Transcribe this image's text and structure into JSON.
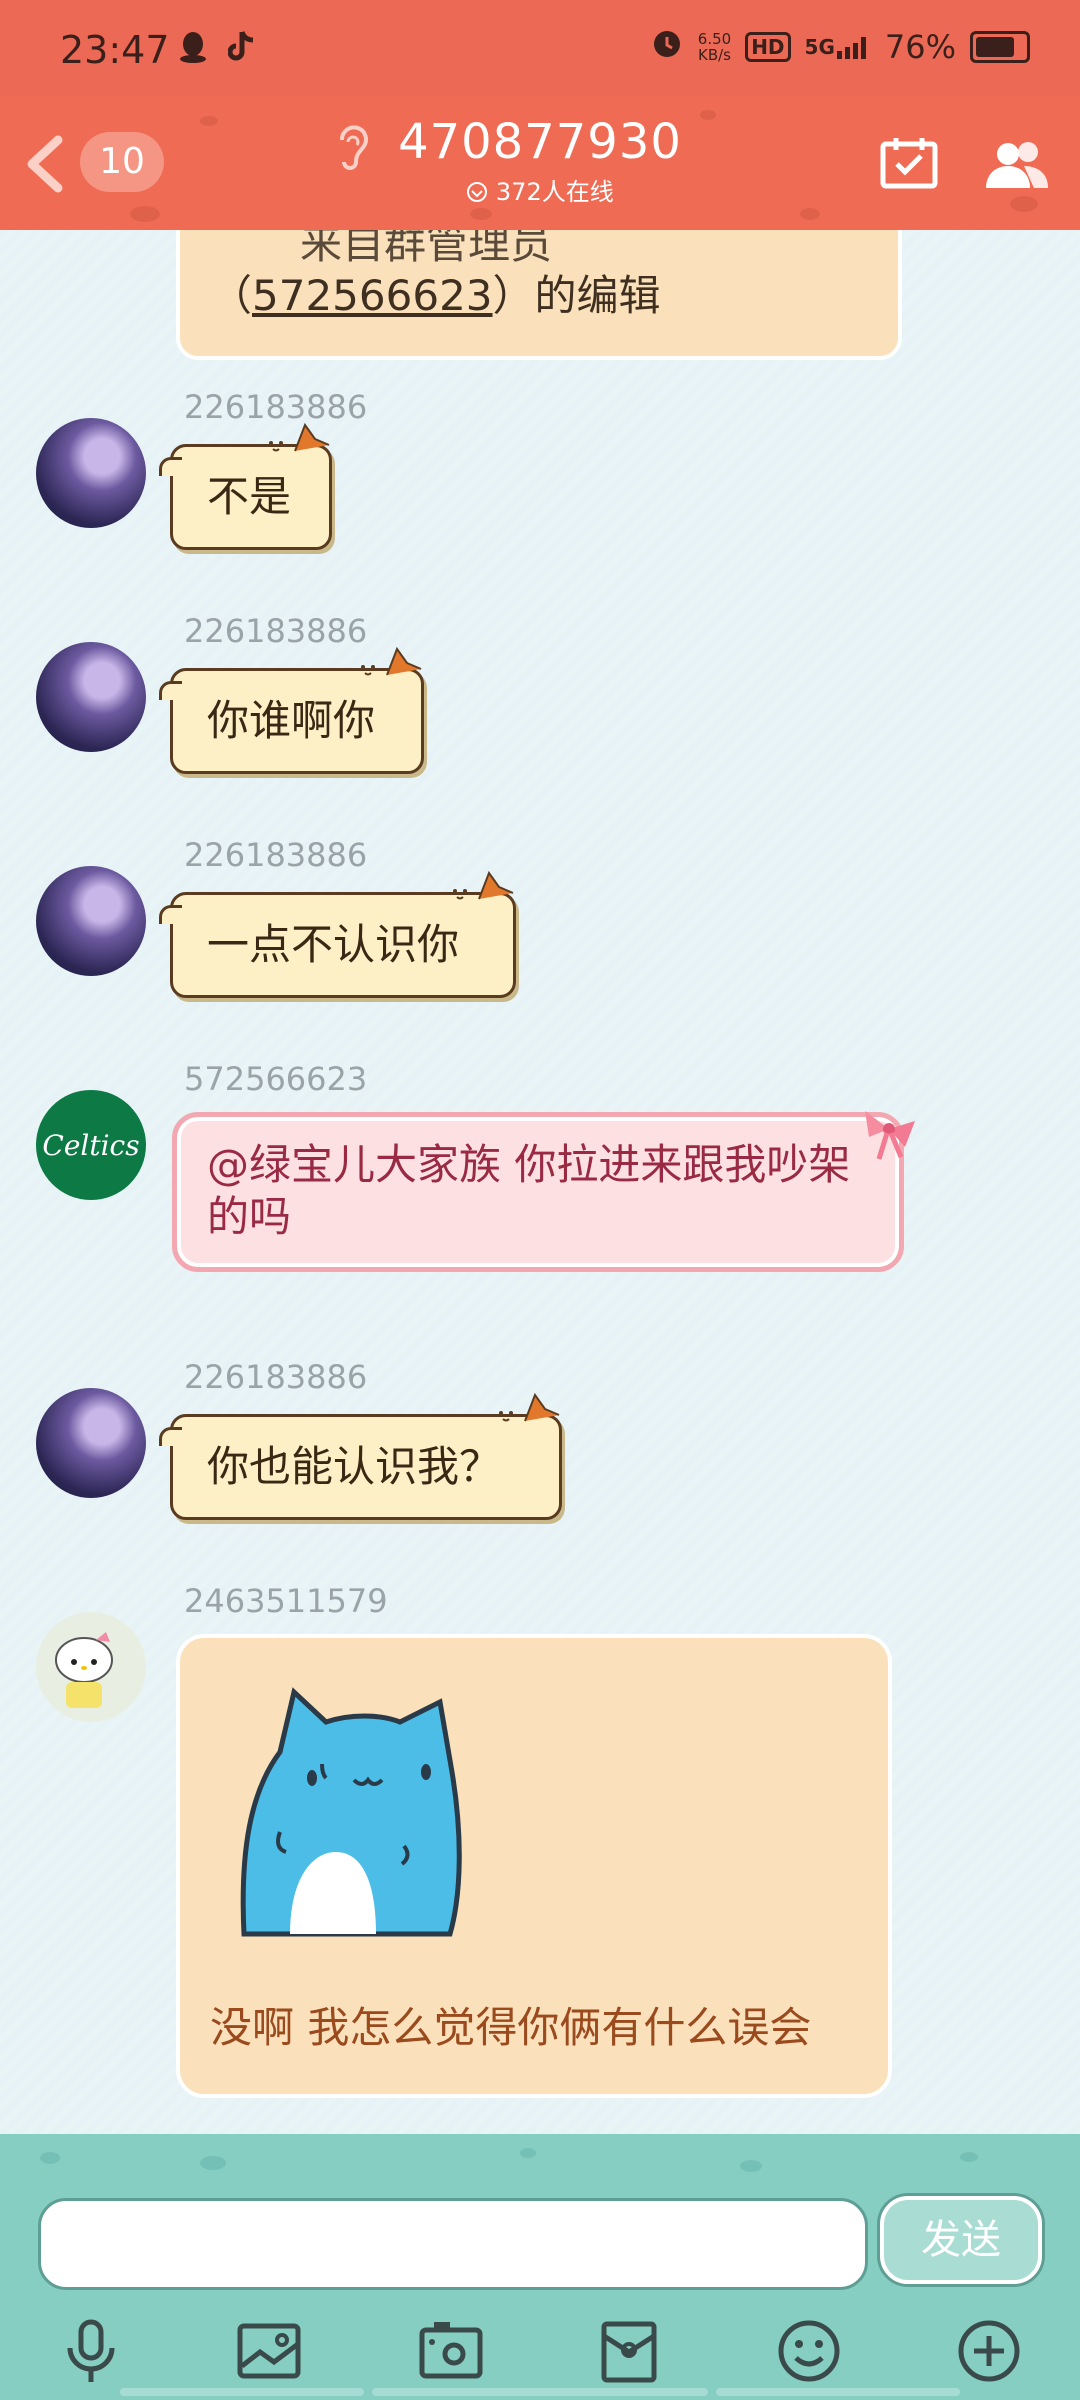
{
  "status_bar": {
    "time": "23:47",
    "left_icons": [
      "qq-icon",
      "tiktok-icon"
    ],
    "alarm_icon": "alarm-icon",
    "net_speed_value": "6.50",
    "net_speed_unit": "KB/s",
    "hd_label": "HD",
    "network_label": "5G",
    "battery_percent": "76%"
  },
  "header": {
    "unread_count": "10",
    "group_number": "470877930",
    "online_text": "372人在线"
  },
  "notice": {
    "line1": "来自群管理员",
    "line2_open": "（",
    "line2_id": "572566623",
    "line2_close": "）的编辑"
  },
  "messages": [
    {
      "sender": "226183886",
      "text": "不是"
    },
    {
      "sender": "226183886",
      "text": "你谁啊你"
    },
    {
      "sender": "226183886",
      "text": "一点不认识你"
    },
    {
      "sender": "572566623",
      "text": "@绿宝儿大家族 你拉进来跟我吵架的吗",
      "avatar_text": "Celtics"
    },
    {
      "sender": "226183886",
      "text": "你也能认识我？"
    },
    {
      "sender": "2463511579",
      "text": "没啊 我怎么觉得你俩有什么误会"
    }
  ],
  "input": {
    "value": "",
    "send_label": "发送"
  },
  "toolbar_icons": [
    "microphone-icon",
    "image-icon",
    "camera-icon",
    "red-packet-icon",
    "emoji-icon",
    "plus-icon"
  ],
  "colors": {
    "header_bg": "#ef6b54",
    "input_bar_bg": "#86cdc2",
    "cat_bubble_bg": "#fdf0c6",
    "pink_bubble_bg": "#fde1e2",
    "sticker_bubble_bg": "#fae1bb"
  }
}
